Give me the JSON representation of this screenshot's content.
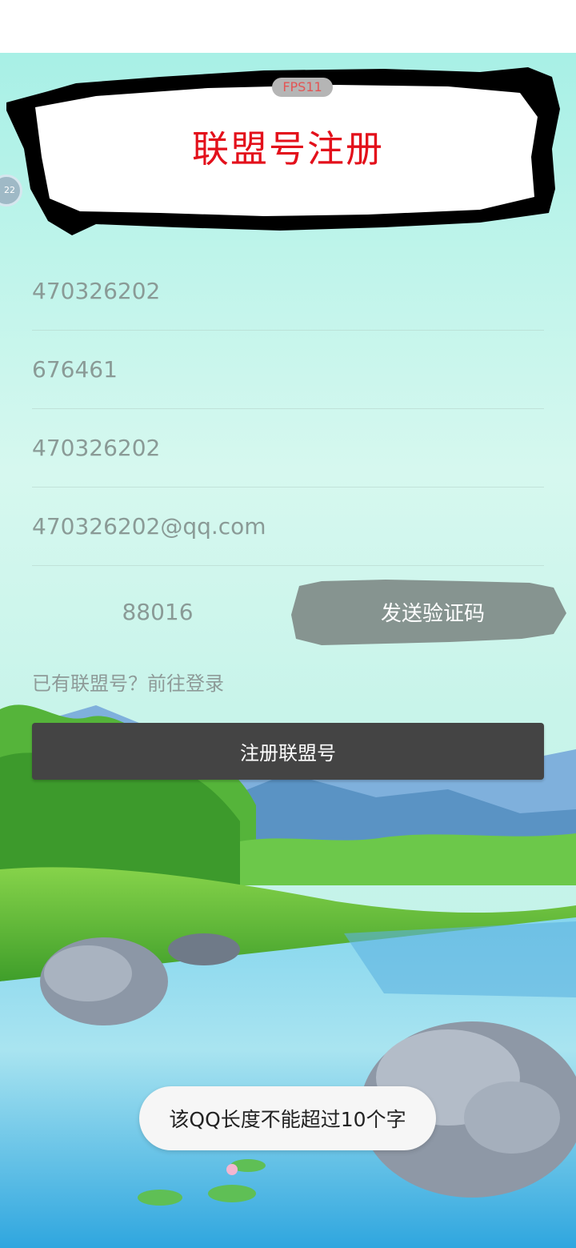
{
  "title": "联盟号注册",
  "fps_badge": "FPS11",
  "floating_ball_label": "22",
  "form": {
    "qq_value": "470326202",
    "password_value": "676461",
    "confirm_value": "470326202",
    "email_value": "470326202@qq.com",
    "code_value": "88016",
    "send_code_label": "发送验证码",
    "login_link": "已有联盟号？前往登录",
    "register_label": "注册联盟号"
  },
  "toast": "该QQ长度不能超过10个字",
  "colors": {
    "title": "#e3101b",
    "register_button": "#444444",
    "send_button": "#869490",
    "sky_top": "#a9f1e8",
    "sky_mid": "#d8f7ef"
  }
}
